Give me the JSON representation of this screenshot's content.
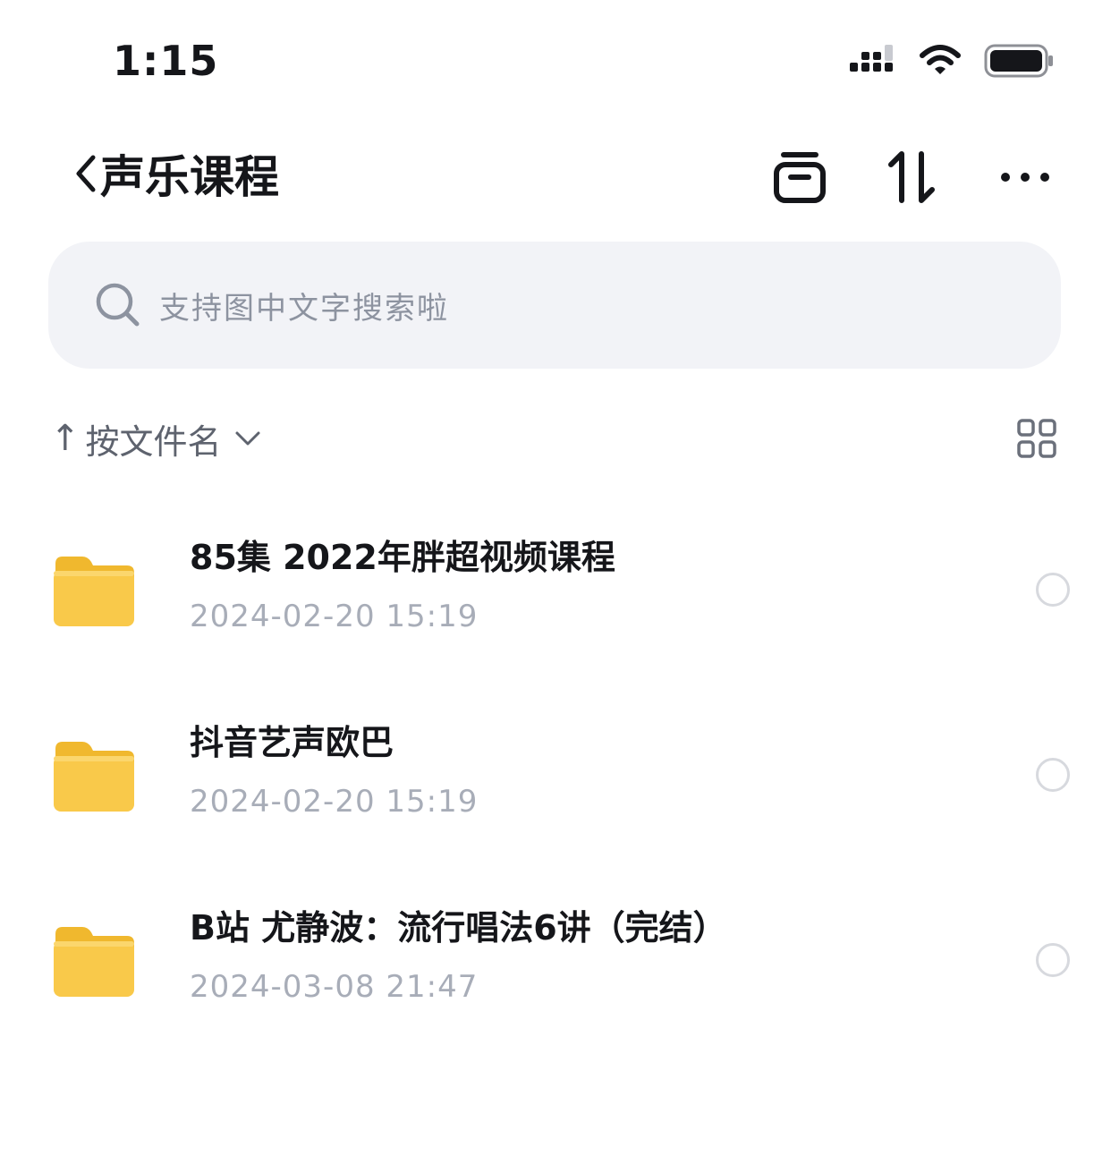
{
  "status_bar": {
    "time": "1:15"
  },
  "header": {
    "title": "声乐课程"
  },
  "search": {
    "placeholder": "支持图中文字搜索啦"
  },
  "sort": {
    "label": "按文件名"
  },
  "files": [
    {
      "name": "85集 2022年胖超视频课程",
      "date": "2024-02-20 15:19"
    },
    {
      "name": "抖音艺声欧巴",
      "date": "2024-02-20 15:19"
    },
    {
      "name": "B站 尤静波：流行唱法6讲（完结）",
      "date": "2024-03-08 21:47"
    }
  ],
  "colors": {
    "folder": "#f9c94a",
    "search_bg": "#f2f3f7",
    "date_text": "#a8adb8"
  }
}
